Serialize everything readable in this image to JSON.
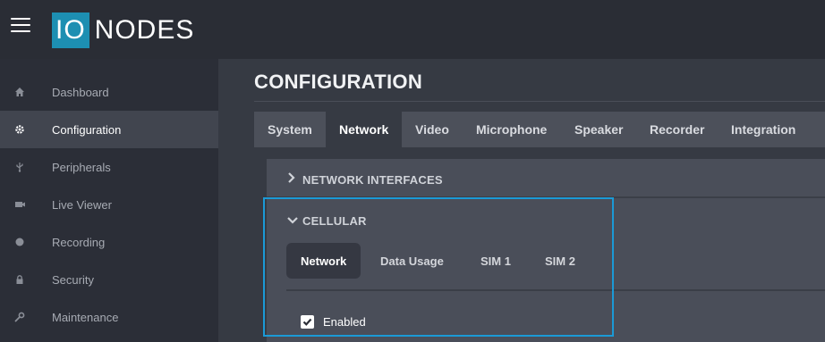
{
  "app": {
    "logo_box": "IO",
    "logo_text": "NODES",
    "accent_color": "#1d8fb2"
  },
  "sidebar": {
    "items": [
      {
        "label": "Dashboard",
        "icon": "home-icon"
      },
      {
        "label": "Configuration",
        "icon": "gear-icon"
      },
      {
        "label": "Peripherals",
        "icon": "usb-icon"
      },
      {
        "label": "Live Viewer",
        "icon": "camera-icon"
      },
      {
        "label": "Recording",
        "icon": "record-icon"
      },
      {
        "label": "Security",
        "icon": "lock-icon"
      },
      {
        "label": "Maintenance",
        "icon": "wrench-icon"
      }
    ],
    "active": "Configuration"
  },
  "main": {
    "title": "CONFIGURATION",
    "tabs": [
      {
        "label": "System"
      },
      {
        "label": "Network"
      },
      {
        "label": "Video"
      },
      {
        "label": "Microphone"
      },
      {
        "label": "Speaker"
      },
      {
        "label": "Recorder"
      },
      {
        "label": "Integration"
      }
    ],
    "active_tab": "Network",
    "sections": {
      "network_interfaces": {
        "label": "NETWORK INTERFACES",
        "expanded": false
      },
      "cellular": {
        "label": "CELLULAR",
        "expanded": true,
        "subtabs": [
          {
            "label": "Network"
          },
          {
            "label": "Data Usage"
          },
          {
            "label": "SIM 1"
          },
          {
            "label": "SIM 2"
          }
        ],
        "active_subtab": "Network",
        "enabled_label": "Enabled",
        "enabled": true
      }
    }
  },
  "highlight_color": "#1b9ad6"
}
